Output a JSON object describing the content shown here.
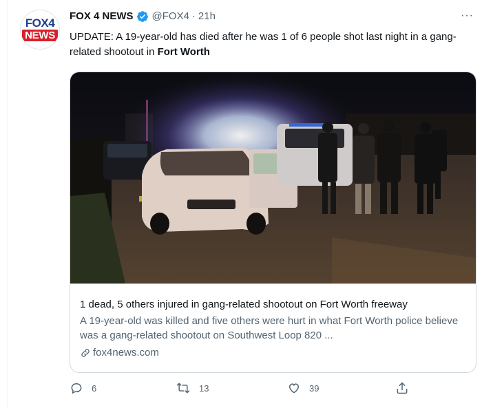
{
  "tweet": {
    "avatar": {
      "top": "FOX4",
      "bottom": "NEWS"
    },
    "author_name": "FOX 4 NEWS",
    "handle": "@FOX4",
    "time": "21h",
    "more_label": "···",
    "text_main": "UPDATE: A 19-year-old has died after he was 1 of 6 people shot last night in a gang-related shootout in ",
    "text_bold": "Fort Worth"
  },
  "card": {
    "title": "1 dead, 5 others injured in gang-related shootout on Fort Worth freeway",
    "description": "A 19-year-old was killed and five others were hurt in what Fort Worth police believe was a gang-related shootout on Southwest Loop 820 ...",
    "domain": "fox4news.com"
  },
  "actions": {
    "reply_count": "6",
    "retweet_count": "13",
    "like_count": "39"
  },
  "colors": {
    "verified": "#1d9bf0",
    "secondary_text": "#536471",
    "brand_red": "#d6202b",
    "brand_blue": "#1c3e8c"
  },
  "icons": [
    "verified-icon",
    "more-icon",
    "link-icon",
    "reply-icon",
    "retweet-icon",
    "like-icon",
    "share-icon"
  ]
}
